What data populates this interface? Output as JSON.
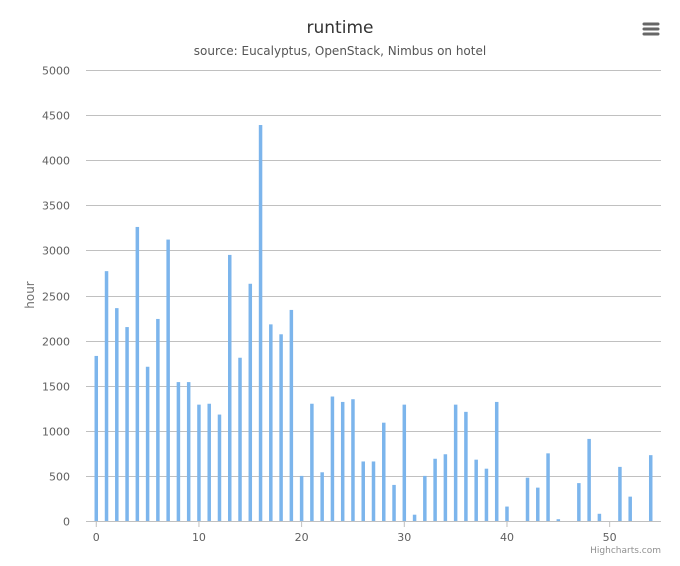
{
  "chart_data": {
    "type": "bar",
    "title": "runtime",
    "subtitle": "source: Eucalyptus, OpenStack, Nimbus on hotel",
    "xlabel": "",
    "ylabel": "hour",
    "xlim": [
      -1,
      55
    ],
    "ylim": [
      0,
      5000
    ],
    "x_ticks": [
      0,
      10,
      20,
      30,
      40,
      50
    ],
    "y_ticks": [
      0,
      500,
      1000,
      1500,
      2000,
      2500,
      3000,
      3500,
      4000,
      4500,
      5000
    ],
    "grid": true,
    "legend": "none",
    "color": "#7cb5ec",
    "x": [
      0,
      1,
      2,
      3,
      4,
      5,
      6,
      7,
      8,
      9,
      10,
      11,
      12,
      13,
      14,
      15,
      16,
      17,
      18,
      19,
      20,
      21,
      22,
      23,
      24,
      25,
      26,
      27,
      28,
      29,
      30,
      31,
      32,
      33,
      34,
      35,
      36,
      37,
      38,
      39,
      40,
      41,
      42,
      43,
      44,
      45,
      46,
      47,
      48,
      49,
      50,
      51,
      52,
      53,
      54
    ],
    "values": [
      1830,
      2770,
      2360,
      2150,
      3260,
      1710,
      2240,
      3120,
      1540,
      1540,
      1290,
      1300,
      1180,
      2950,
      1810,
      2630,
      4390,
      2180,
      2070,
      2340,
      500,
      1300,
      540,
      1380,
      1320,
      1350,
      660,
      660,
      1090,
      400,
      1290,
      70,
      500,
      690,
      740,
      1290,
      1210,
      680,
      580,
      1320,
      160,
      0,
      480,
      370,
      750,
      20,
      0,
      420,
      910,
      80,
      0,
      600,
      270,
      0,
      730
    ]
  },
  "menu": {
    "icon": "hamburger-menu-icon"
  },
  "credits": "Highcharts.com"
}
